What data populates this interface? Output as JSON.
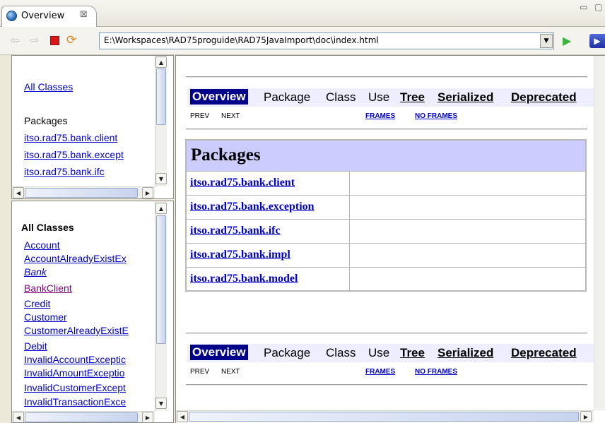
{
  "tab": {
    "title": "Overview",
    "close_glyph": "⊠"
  },
  "window_controls": "▭ ▢",
  "toolbar": {
    "back": "⇦",
    "forward": "⇨",
    "refresh": "⟳",
    "address": "E:\\Workspaces\\RAD75proguide\\RAD75JavaImport\\doc\\index.html",
    "go": "▶",
    "dropdown": "▼",
    "nav": "▶"
  },
  "packages_frame": {
    "all_classes_link": "All Classes",
    "heading": "Packages",
    "packages": [
      "itso.rad75.bank.client",
      "itso.rad75.bank.except",
      "itso.rad75.bank.ifc"
    ]
  },
  "classes_frame": {
    "heading": "All Classes",
    "classes": [
      {
        "label": "Account",
        "style": "normal"
      },
      {
        "label": "AccountAlreadyExistEx",
        "style": "normal"
      },
      {
        "label": "Bank",
        "style": "italic"
      },
      {
        "label": "BankClient",
        "style": "visited"
      },
      {
        "label": "Credit",
        "style": "normal"
      },
      {
        "label": "Customer",
        "style": "normal"
      },
      {
        "label": "CustomerAlreadyExistE",
        "style": "normal"
      },
      {
        "label": "Debit",
        "style": "normal"
      },
      {
        "label": "InvalidAccountExceptic",
        "style": "normal"
      },
      {
        "label": "InvalidAmountExceptio",
        "style": "normal"
      },
      {
        "label": "InvalidCustomerExcept",
        "style": "normal"
      },
      {
        "label": "InvalidTransactionExce",
        "style": "normal"
      }
    ]
  },
  "main": {
    "nav": {
      "overview": "Overview",
      "package": "Package",
      "class": "Class",
      "use": "Use",
      "tree": "Tree",
      "serialized": "Serialized",
      "deprecated": "Deprecated"
    },
    "subnav": {
      "prev": "PREV",
      "next": "NEXT",
      "frames": "FRAMES",
      "no_frames": "NO FRAMES"
    },
    "table_heading": "Packages",
    "packages": [
      "itso.rad75.bank.client",
      "itso.rad75.bank.exception",
      "itso.rad75.bank.ifc",
      "itso.rad75.bank.impl",
      "itso.rad75.bank.model"
    ]
  },
  "scroll": {
    "up": "▲",
    "down": "▼",
    "left": "◀",
    "right": "▶",
    "grip": "≡",
    "hgrip": "|||"
  },
  "colors": {
    "nav_current_bg": "#00008b",
    "table_header_bg": "#ccccff",
    "link": "#0000cc",
    "visited": "#800080"
  }
}
